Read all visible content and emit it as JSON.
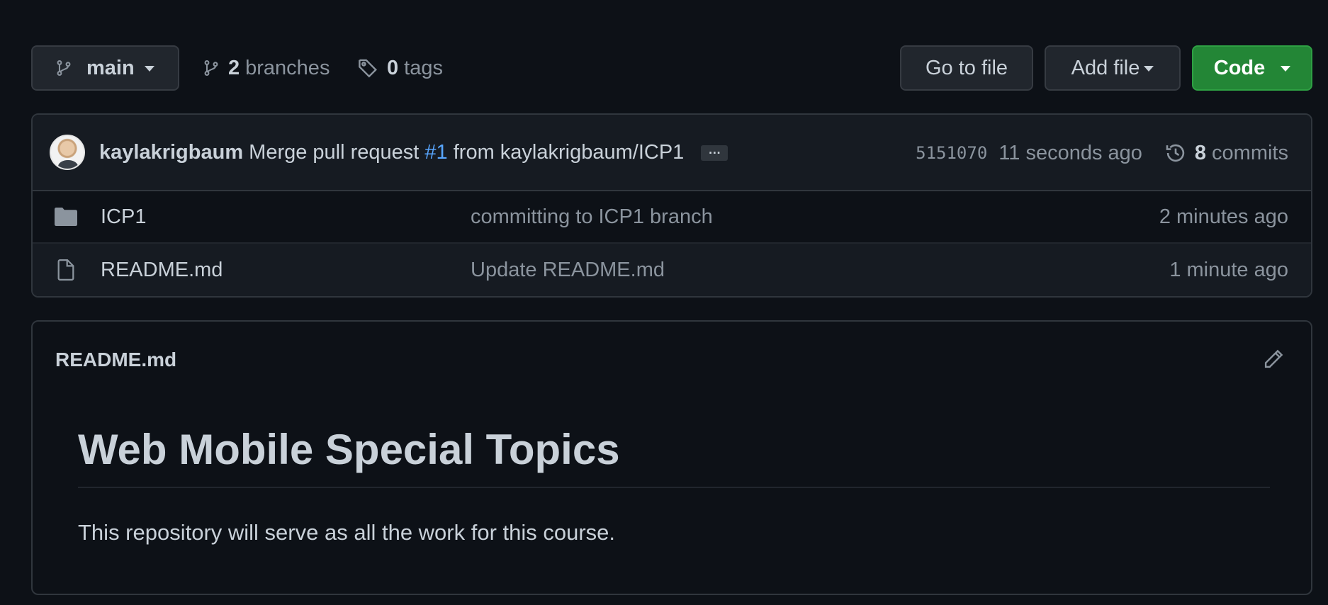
{
  "toolbar": {
    "branch": "main",
    "branches_count": "2",
    "branches_label": "branches",
    "tags_count": "0",
    "tags_label": "tags",
    "goto_file": "Go to file",
    "add_file": "Add file",
    "code": "Code"
  },
  "commit": {
    "author": "kaylakrigbaum",
    "message_prefix": "Merge pull request",
    "pr_ref": "#1",
    "message_suffix": "from kaylakrigbaum/ICP1",
    "ellipsis": "…",
    "sha": "5151070",
    "time": "11 seconds ago",
    "commits_count": "8",
    "commits_label": "commits"
  },
  "files": [
    {
      "icon": "folder-icon",
      "name": "ICP1",
      "message": "committing to ICP1 branch",
      "age": "2 minutes ago"
    },
    {
      "icon": "file-icon",
      "name": "README.md",
      "message": "Update README.md",
      "age": "1 minute ago"
    }
  ],
  "readme": {
    "filename": "README.md",
    "heading": "Web Mobile Special Topics",
    "body": "This repository will serve as all the work for this course."
  },
  "colors": {
    "background": "#0d1117",
    "accent_green": "#238636",
    "link_blue": "#58a6ff"
  }
}
